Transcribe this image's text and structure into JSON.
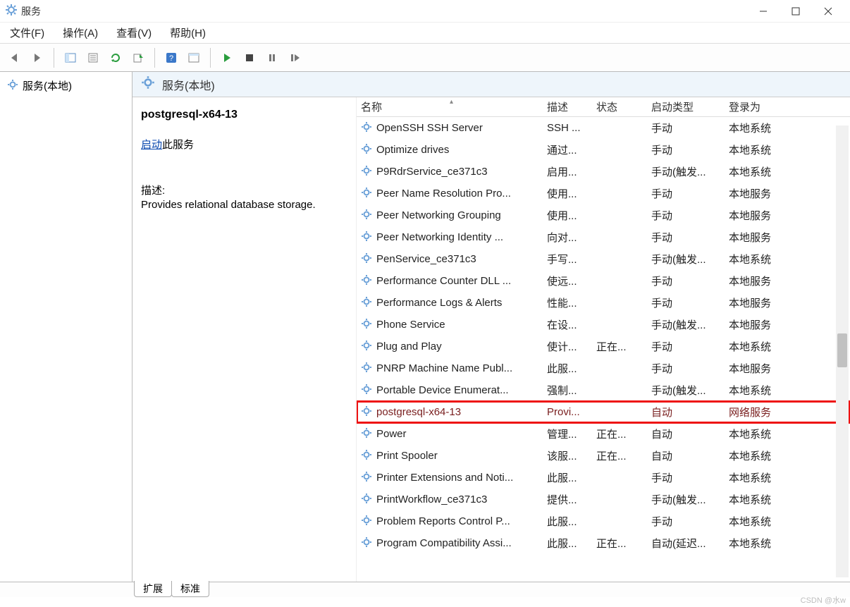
{
  "window": {
    "title": "服务"
  },
  "menu": {
    "file": "文件(F)",
    "action": "操作(A)",
    "view": "查看(V)",
    "help": "帮助(H)"
  },
  "left": {
    "node": "服务(本地)"
  },
  "right_header": {
    "label": "服务(本地)"
  },
  "detail": {
    "service_name": "postgresql-x64-13",
    "start_link": "启动",
    "start_rest": "此服务",
    "desc_label": "描述:",
    "desc_text": "Provides relational database storage."
  },
  "columns": {
    "name": "名称",
    "desc": "描述",
    "status": "状态",
    "start": "启动类型",
    "login": "登录为"
  },
  "tabs": {
    "ext": "扩展",
    "std": "标准"
  },
  "watermark": "CSDN @水w",
  "services": [
    {
      "name": "OpenSSH SSH Server",
      "desc": "SSH ...",
      "status": "",
      "start": "手动",
      "login": "本地系统"
    },
    {
      "name": "Optimize drives",
      "desc": "通过...",
      "status": "",
      "start": "手动",
      "login": "本地系统"
    },
    {
      "name": "P9RdrService_ce371c3",
      "desc": "启用...",
      "status": "",
      "start": "手动(触发...",
      "login": "本地系统"
    },
    {
      "name": "Peer Name Resolution Pro...",
      "desc": "使用...",
      "status": "",
      "start": "手动",
      "login": "本地服务"
    },
    {
      "name": "Peer Networking Grouping",
      "desc": "使用...",
      "status": "",
      "start": "手动",
      "login": "本地服务"
    },
    {
      "name": "Peer Networking Identity ...",
      "desc": "向对...",
      "status": "",
      "start": "手动",
      "login": "本地服务"
    },
    {
      "name": "PenService_ce371c3",
      "desc": "手写...",
      "status": "",
      "start": "手动(触发...",
      "login": "本地系统"
    },
    {
      "name": "Performance Counter DLL ...",
      "desc": "使远...",
      "status": "",
      "start": "手动",
      "login": "本地服务"
    },
    {
      "name": "Performance Logs & Alerts",
      "desc": "性能...",
      "status": "",
      "start": "手动",
      "login": "本地服务"
    },
    {
      "name": "Phone Service",
      "desc": "在设...",
      "status": "",
      "start": "手动(触发...",
      "login": "本地服务"
    },
    {
      "name": "Plug and Play",
      "desc": "使计...",
      "status": "正在...",
      "start": "手动",
      "login": "本地系统"
    },
    {
      "name": "PNRP Machine Name Publ...",
      "desc": "此服...",
      "status": "",
      "start": "手动",
      "login": "本地服务"
    },
    {
      "name": "Portable Device Enumerat...",
      "desc": "强制...",
      "status": "",
      "start": "手动(触发...",
      "login": "本地系统"
    },
    {
      "name": "postgresql-x64-13",
      "desc": "Provi...",
      "status": "",
      "start": "自动",
      "login": "网络服务",
      "hl": true
    },
    {
      "name": "Power",
      "desc": "管理...",
      "status": "正在...",
      "start": "自动",
      "login": "本地系统"
    },
    {
      "name": "Print Spooler",
      "desc": "该服...",
      "status": "正在...",
      "start": "自动",
      "login": "本地系统"
    },
    {
      "name": "Printer Extensions and Noti...",
      "desc": "此服...",
      "status": "",
      "start": "手动",
      "login": "本地系统"
    },
    {
      "name": "PrintWorkflow_ce371c3",
      "desc": "提供...",
      "status": "",
      "start": "手动(触发...",
      "login": "本地系统"
    },
    {
      "name": "Problem Reports Control P...",
      "desc": "此服...",
      "status": "",
      "start": "手动",
      "login": "本地系统"
    },
    {
      "name": "Program Compatibility Assi...",
      "desc": "此服...",
      "status": "正在...",
      "start": "自动(延迟...",
      "login": "本地系统"
    }
  ]
}
